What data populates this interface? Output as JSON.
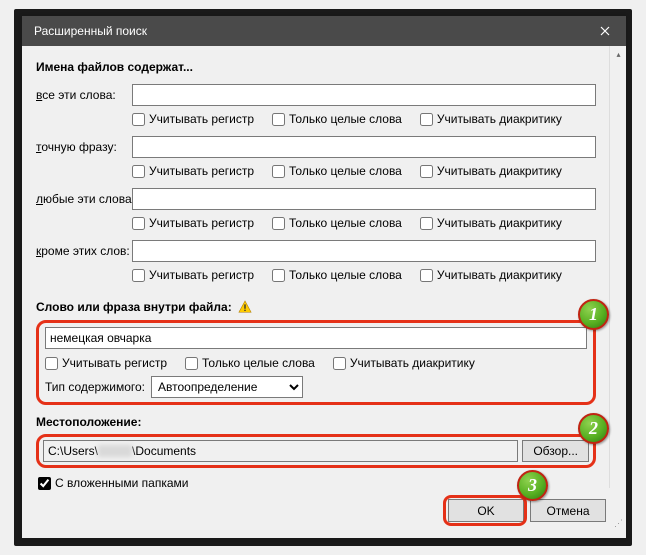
{
  "title": "Расширенный поиск",
  "section_filenames": {
    "header": "Имена файлов содержат...",
    "labels": {
      "all_words": "все эти слова:",
      "exact_phrase": "точную фразу:",
      "any_words": "любые эти слова:",
      "none_words": "кроме этих слов:"
    },
    "values": {
      "all_words": "",
      "exact_phrase": "",
      "any_words": "",
      "none_words": ""
    },
    "checks": {
      "case": "Учитывать регистр",
      "whole": "Только целые слова",
      "diacritic": "Учитывать диакритику"
    }
  },
  "section_phrase": {
    "header": "Слово или фраза внутри файла:",
    "phrase_value": "немецкая овчарка",
    "checks": {
      "case": "Учитывать регистр",
      "whole": "Только целые слова",
      "diacritic": "Учитывать диакритику"
    },
    "type_label": "Тип содержимого:",
    "type_options": [
      "Автоопределение"
    ]
  },
  "section_location": {
    "header": "Местоположение:",
    "path_prefix": "C:\\Users\\",
    "path_suffix": "\\Documents",
    "browse": "Обзор...",
    "subfolders": "С вложенными папками"
  },
  "buttons": {
    "ok": "OK",
    "cancel": "Отмена"
  },
  "badges": {
    "b1": "1",
    "b2": "2",
    "b3": "3"
  }
}
